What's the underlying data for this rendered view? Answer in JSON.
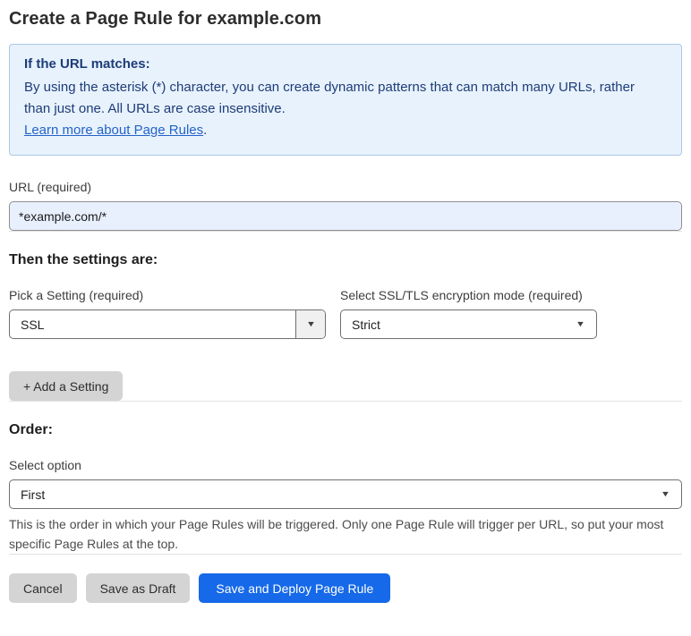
{
  "page": {
    "title": "Create a Page Rule for example.com"
  },
  "info_box": {
    "heading": "If the URL matches:",
    "body": "By using the asterisk (*) character, you can create dynamic patterns that can match many URLs, rather than just one. All URLs are case insensitive.",
    "link_label": "Learn more about Page Rules",
    "link_suffix": "."
  },
  "url_field": {
    "label": "URL (required)",
    "value": "*example.com/*"
  },
  "settings_section": {
    "heading": "Then the settings are:",
    "setting_picker": {
      "label": "Pick a Setting (required)",
      "value": "SSL"
    },
    "ssl_mode_picker": {
      "label": "Select SSL/TLS encryption mode (required)",
      "value": "Strict"
    },
    "add_setting_label": "+ Add a Setting"
  },
  "order_section": {
    "heading": "Order:",
    "select_label": "Select option",
    "value": "First",
    "help_text": "This is the order in which your Page Rules will be triggered. Only one Page Rule will trigger per URL, so put your most specific Page Rules at the top."
  },
  "footer": {
    "cancel_label": "Cancel",
    "save_draft_label": "Save as Draft",
    "save_deploy_label": "Save and Deploy Page Rule"
  },
  "icons": {
    "dropdown_caret": "▼"
  },
  "colors": {
    "primary_button": "#1669e8",
    "secondary_button": "#d4d4d4",
    "info_background": "#e8f2fc",
    "info_border": "#aac8e4",
    "info_text": "#1d3c78",
    "link": "#2363c8",
    "url_input_background": "#e8f0fe"
  }
}
